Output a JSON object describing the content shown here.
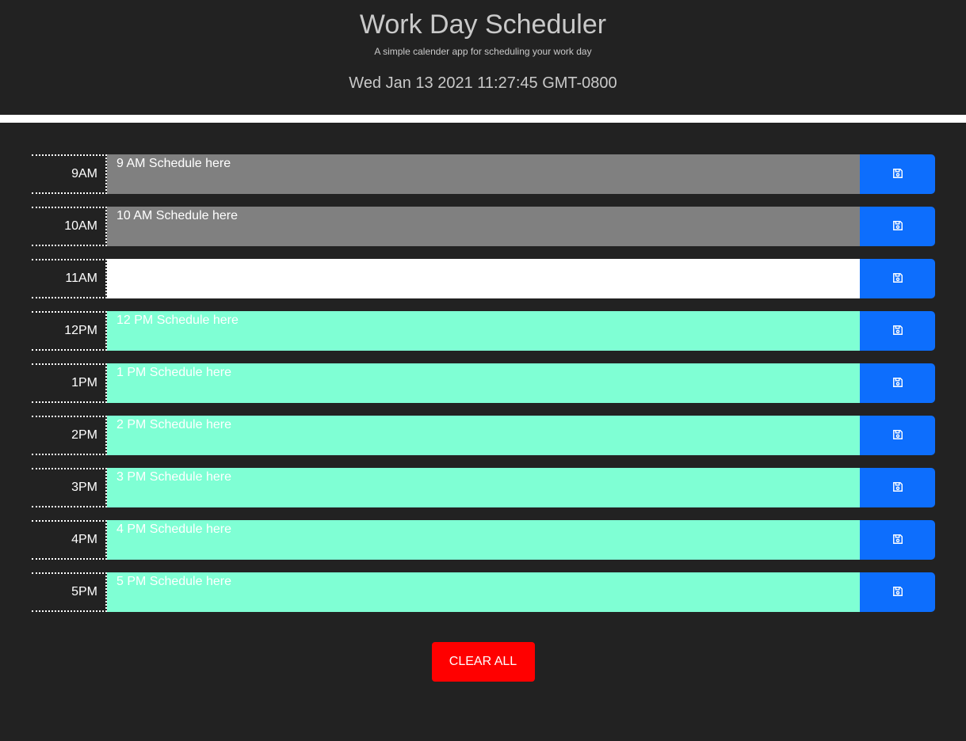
{
  "header": {
    "title": "Work Day Scheduler",
    "subtitle": "A simple calender app for scheduling your work day",
    "current_day": "Wed Jan 13 2021 11:27:45 GMT-0800"
  },
  "colors": {
    "past": "#808080",
    "present": "#ffffff",
    "future": "#7fffd4",
    "save_button": "#0d6efd",
    "clear_button": "#ff0000",
    "background": "#222222"
  },
  "time_blocks": [
    {
      "hour": "9AM",
      "text": "9 AM Schedule here",
      "state": "past",
      "save_icon": "floppy-disk-icon"
    },
    {
      "hour": "10AM",
      "text": "10 AM Schedule here",
      "state": "past",
      "save_icon": "floppy-disk-icon"
    },
    {
      "hour": "11AM",
      "text": "",
      "state": "present",
      "save_icon": "floppy-disk-icon"
    },
    {
      "hour": "12PM",
      "text": "12 PM Schedule here",
      "state": "future",
      "save_icon": "floppy-disk-icon"
    },
    {
      "hour": "1PM",
      "text": "1 PM Schedule here",
      "state": "future",
      "save_icon": "floppy-disk-icon"
    },
    {
      "hour": "2PM",
      "text": "2 PM Schedule here",
      "state": "future",
      "save_icon": "floppy-disk-icon"
    },
    {
      "hour": "3PM",
      "text": "3 PM Schedule here",
      "state": "future",
      "save_icon": "floppy-disk-icon"
    },
    {
      "hour": "4PM",
      "text": "4 PM Schedule here",
      "state": "future",
      "save_icon": "floppy-disk-icon"
    },
    {
      "hour": "5PM",
      "text": "5 PM Schedule here",
      "state": "future",
      "save_icon": "floppy-disk-icon"
    }
  ],
  "clear_button": {
    "label": "CLEAR ALL"
  }
}
